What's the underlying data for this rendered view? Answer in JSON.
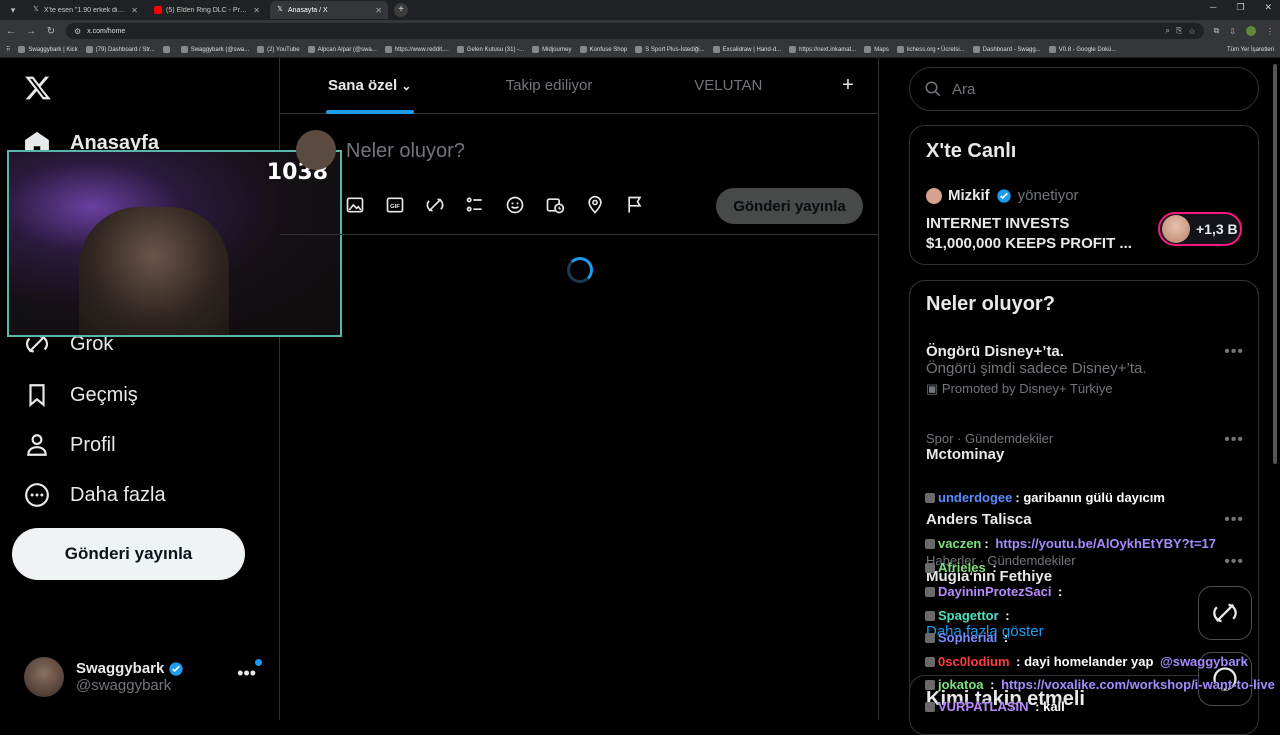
{
  "browser": {
    "tabs": [
      {
        "label": "X'te esen \"1.90 erkek diye tutturu...",
        "icon": "x"
      },
      {
        "label": "(5) Elden Ring DLC - Promised ...",
        "icon": "youtube"
      },
      {
        "label": "Anasayfa / X",
        "icon": "x",
        "active": true
      }
    ],
    "url": "x.com/home",
    "bookmarks": [
      "Swaggybark | Kick",
      "(79) Dashboard / Str...",
      "",
      "Swaggybark (@swa...",
      "(2) YouTube",
      "Alpcan Alpar (@swa...",
      "https://www.reddit....",
      "Gelen Kutusu (31) -...",
      "Midjourney",
      "Konfuse Shop",
      "S Sport Plus-İstediği...",
      "Excalidraw | Hand-d...",
      "https://next.inkamat...",
      "Maps",
      "lichess.org • Ücretsi...",
      "Dashboard - Swagg...",
      "V0.8 - Google Dokü..."
    ],
    "bookmarks_right": "Tüm Yer İşaretleri"
  },
  "nav": {
    "items": [
      {
        "label": "Anasayfa",
        "icon": "home-icon"
      },
      {
        "label": "Grok",
        "icon": "grok-icon"
      },
      {
        "label": "Geçmiş",
        "icon": "bookmark-icon"
      },
      {
        "label": "Profil",
        "icon": "person-icon"
      },
      {
        "label": "Daha fazla",
        "icon": "more-circle-icon"
      }
    ],
    "post_button": "Gönderi yayınla"
  },
  "profile": {
    "display_name": "Swaggybark",
    "handle": "@swaggybark"
  },
  "webcam": {
    "viewer_count": "1038"
  },
  "center": {
    "tabs": [
      "Sana özel",
      "Takip ediliyor",
      "VELUTAN"
    ],
    "active_tab": "Sana özel",
    "composer_placeholder": "Neler oluyor?",
    "composer_button": "Gönderi yayınla"
  },
  "right": {
    "search_placeholder": "Ara",
    "live": {
      "title": "X'te Canlı",
      "host": "Mizkif",
      "host_role": "yönetiyor",
      "stream_title": "INTERNET INVESTS $1,000,000 KEEPS PROFIT ...",
      "listeners": "+1,3 B"
    },
    "trends": {
      "title": "Neler oluyor?",
      "items": [
        {
          "meta": "",
          "title": "Öngörü Disney+’ta.",
          "desc": "Öngörü şimdi sadece Disney+’ta.",
          "promo": "Promoted by Disney+ Türkiye"
        },
        {
          "meta": "Spor · Gündemdekiler",
          "title": "Mctominay",
          "desc": "",
          "promo": ""
        },
        {
          "meta": "",
          "title": "Anders Talisca",
          "desc": "",
          "promo": ""
        },
        {
          "meta": "Haberler · Gündemdekiler",
          "title": "Muğla'nın Fethiye",
          "desc": "",
          "promo": ""
        }
      ],
      "show_more": "Daha fazla göster"
    },
    "who_to_follow": "Kimi takip etmeli"
  },
  "chat": [
    {
      "user": "underdogee",
      "color": "#5b8cff",
      "msg": ": garibanın gülü dayıcım",
      "link": ""
    },
    {
      "user": "vaczen",
      "color": "#7ee07e",
      "msg": ": ",
      "link": "https://youtu.be/AlOykhEtYBY?t=17"
    },
    {
      "user": "Afrieles",
      "color": "#7ee07e",
      "msg": " :",
      "link": ""
    },
    {
      "user": "DayininProtezSaci",
      "color": "#b98bff",
      "msg": " :",
      "link": ""
    },
    {
      "user": "Spagettor",
      "color": "#4ee0c0",
      "msg": " :",
      "link": ""
    },
    {
      "user": "Sopherial",
      "color": "#7a8cff",
      "msg": " :",
      "link": ""
    },
    {
      "user": "0sc0lodium",
      "color": "#ff3b3b",
      "msg": " : dayi homelander yap ",
      "link": "@swaggybark"
    },
    {
      "user": "jokatoa",
      "color": "#7ee07e",
      "msg": " : ",
      "link": "https://voxalike.com/workshop/i-want-to-live"
    },
    {
      "user": "VURPATLASIN",
      "color": "#b98bff",
      "msg": " : kall",
      "link": ""
    }
  ]
}
